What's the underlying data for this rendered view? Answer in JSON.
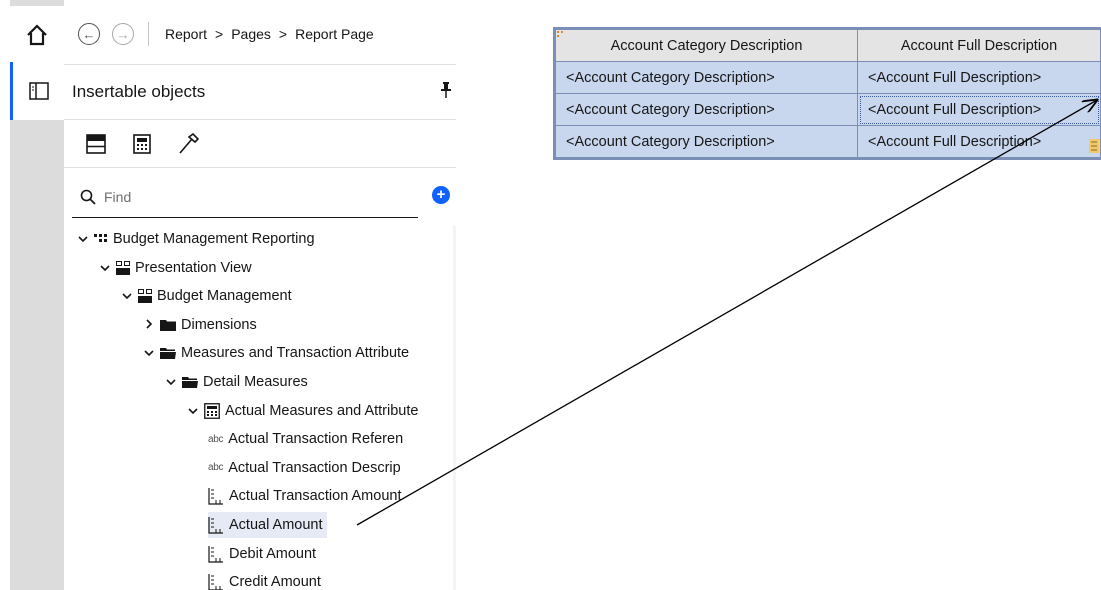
{
  "rail": {
    "home_icon": "home-icon",
    "objects_icon": "insertable-objects-icon"
  },
  "breadcrumb": {
    "back_icon": "back-arrow-icon",
    "forward_icon": "forward-arrow-icon",
    "items": [
      "Report",
      "Pages",
      "Report Page"
    ]
  },
  "insertable": {
    "title": "Insertable objects",
    "pin_icon": "pin-icon",
    "tabs": [
      {
        "icon": "source-icon"
      },
      {
        "icon": "data-items-icon"
      },
      {
        "icon": "toolbox-hammer-icon"
      }
    ],
    "find_placeholder": "Find",
    "add_icon": "add-circle-icon"
  },
  "tree": [
    {
      "label": "Budget Management Reporting",
      "level": 0,
      "expanded": true,
      "icon": "package-icon"
    },
    {
      "label": "Presentation View",
      "level": 1,
      "expanded": true,
      "icon": "namespace-icon"
    },
    {
      "label": "Budget Management",
      "level": 2,
      "expanded": true,
      "icon": "namespace-icon"
    },
    {
      "label": "Dimensions",
      "level": 3,
      "expanded": false,
      "icon": "folder-icon"
    },
    {
      "label": "Measures and Transaction Attribute",
      "level": 3,
      "expanded": true,
      "icon": "folder-open-icon"
    },
    {
      "label": "Detail Measures",
      "level": 4,
      "expanded": true,
      "icon": "folder-open-icon"
    },
    {
      "label": "Actual Measures and Attribute",
      "level": 5,
      "expanded": true,
      "icon": "query-subject-icon"
    },
    {
      "label": "Actual Transaction Referen",
      "level": 6,
      "icon": "text-item-icon"
    },
    {
      "label": "Actual Transaction Descrip",
      "level": 6,
      "icon": "text-item-icon"
    },
    {
      "label": "Actual Transaction Amount",
      "level": 6,
      "icon": "measure-icon"
    },
    {
      "label": "Actual Amount",
      "level": 6,
      "icon": "measure-icon",
      "selected": true
    },
    {
      "label": "Debit Amount",
      "level": 6,
      "icon": "measure-icon"
    },
    {
      "label": "Credit Amount",
      "level": 6,
      "icon": "measure-icon"
    }
  ],
  "tree_text": {
    "abc": "abc"
  },
  "report_table": {
    "headers": [
      "Account Category Description",
      "Account Full Description"
    ],
    "rows": [
      [
        "<Account Category Description>",
        "<Account Full Description>"
      ],
      [
        "<Account Category Description>",
        "<Account Full Description>"
      ],
      [
        "<Account Category Description>",
        "<Account Full Description>"
      ]
    ]
  },
  "colors": {
    "accent": "#0f62fe",
    "table_header": "#e4e4e4",
    "table_body": "#c9d7ee",
    "table_border": "#7b8fb6",
    "selection": "#e5eaf5"
  }
}
